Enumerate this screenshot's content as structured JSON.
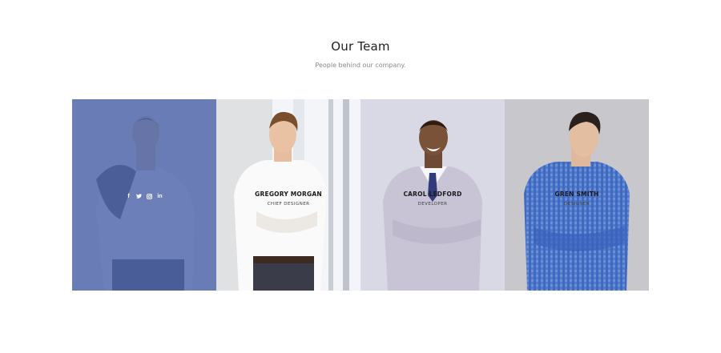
{
  "section": {
    "title": "Our Team",
    "subtitle": "People behind our company."
  },
  "members": [
    {
      "name": "",
      "role": "",
      "social": [
        "f",
        "t",
        "ig",
        "in"
      ]
    },
    {
      "name": "GREGORY MORGAN",
      "role": "CHIEF DESIGNER"
    },
    {
      "name": "CAROL LEDFORD",
      "role": "DEVELOPER"
    },
    {
      "name": "GREN SMITH",
      "role": "DESIGNER"
    }
  ],
  "colors": {
    "overlay": "#5066aa",
    "title": "#1e1e1e",
    "subtitle": "#8a8a8a"
  }
}
